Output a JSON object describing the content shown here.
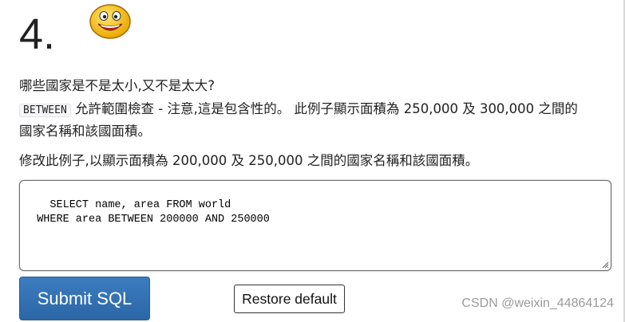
{
  "question": {
    "number": "4.",
    "prompt": "哪些國家是不是太小,又不是太大?",
    "keyword": "BETWEEN",
    "explanation_part1": " 允許範圍檢查 - 注意,這是包含性的。 此例子顯示面積為 250,000 及 300,000 之間的",
    "explanation_part2": "國家名稱和該國面積。",
    "task": "修改此例子,以顯示面積為 200,000 及 250,000 之間的國家名稱和該國面積。"
  },
  "editor": {
    "sql": "SELECT name, area FROM world\n  WHERE area BETWEEN 200000 AND 250000"
  },
  "buttons": {
    "submit_label": "Submit SQL",
    "restore_label": "Restore default"
  },
  "watermark": {
    "text": "CSDN @weixin_44864124"
  },
  "colors": {
    "submit_bg": "#2c67a6",
    "smiley_face": "#f7c21a"
  },
  "icons": {
    "smiley": "smiley-face-icon",
    "resize": "resize-grip-icon"
  }
}
